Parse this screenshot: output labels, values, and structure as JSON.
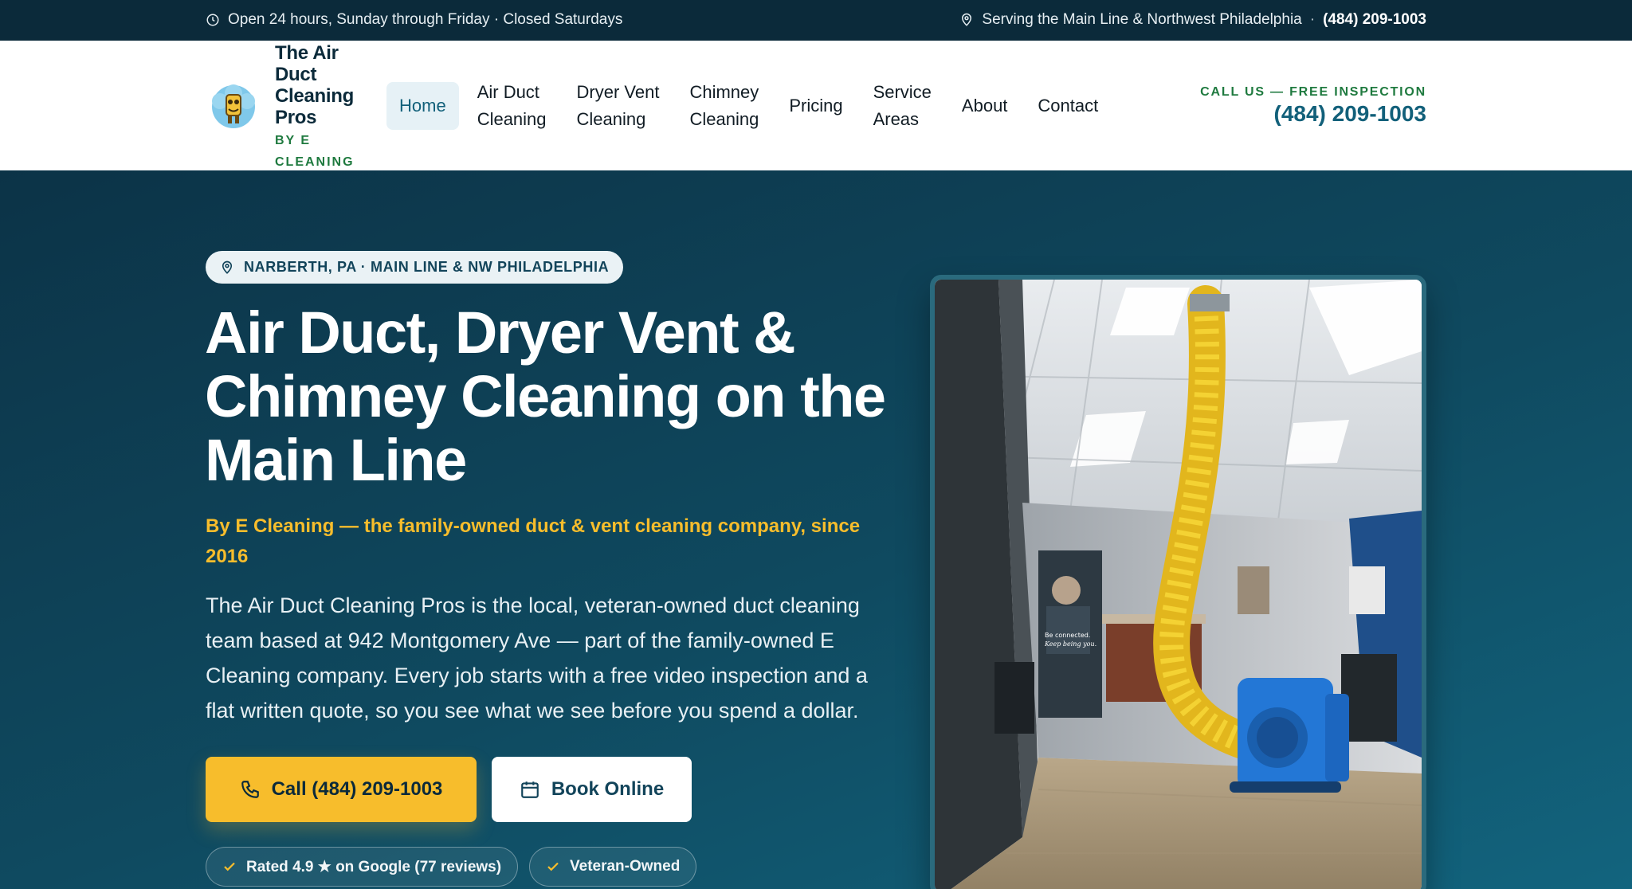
{
  "topbar": {
    "hours": "Open 24 hours, Sunday through Friday · Closed Saturdays",
    "service_area": "Serving the Main Line & Northwest Philadelphia",
    "separator": "·",
    "phone": "(484) 209-1003"
  },
  "logo": {
    "title": "The Air Duct Cleaning Pros",
    "subtitle": "BY E CLEANING"
  },
  "nav": {
    "items": [
      {
        "line1": "Home",
        "line2": ""
      },
      {
        "line1": "Air Duct",
        "line2": "Cleaning"
      },
      {
        "line1": "Dryer Vent",
        "line2": "Cleaning"
      },
      {
        "line1": "Chimney",
        "line2": "Cleaning"
      },
      {
        "line1": "Pricing",
        "line2": ""
      },
      {
        "line1": "Service",
        "line2": "Areas"
      },
      {
        "line1": "About",
        "line2": ""
      },
      {
        "line1": "Contact",
        "line2": ""
      }
    ],
    "active": "Home"
  },
  "call_box": {
    "label": "CALL US — FREE INSPECTION",
    "phone": "(484) 209-1003"
  },
  "hero": {
    "location_pill": "NARBERTH, PA · MAIN LINE & NW PHILADELPHIA",
    "headline": "Air Duct, Dryer Vent & Chimney Cleaning on the Main Line",
    "tagline": "By E Cleaning — the family-owned duct & vent cleaning company, since 2016",
    "description": "The Air Duct Cleaning Pros is the local, veteran-owned duct cleaning team based at 942 Montgomery Ave — part of the family-owned E Cleaning company. Every job starts with a free video inspection and a flat written quote, so you see what we see before you spend a dollar.",
    "cta_call": "Call (484) 209-1003",
    "cta_book": "Book Online",
    "badges": [
      "Rated 4.9 ★ on Google (77 reviews)",
      "Veteran-Owned"
    ],
    "photo_text": {
      "line1": "Be connected.",
      "line2": "Keep being you."
    }
  },
  "colors": {
    "topbar_bg": "#0b2a3a",
    "accent_yellow": "#f7bd2c",
    "brand_teal": "#12607a",
    "brand_green": "#1f7a3f"
  }
}
